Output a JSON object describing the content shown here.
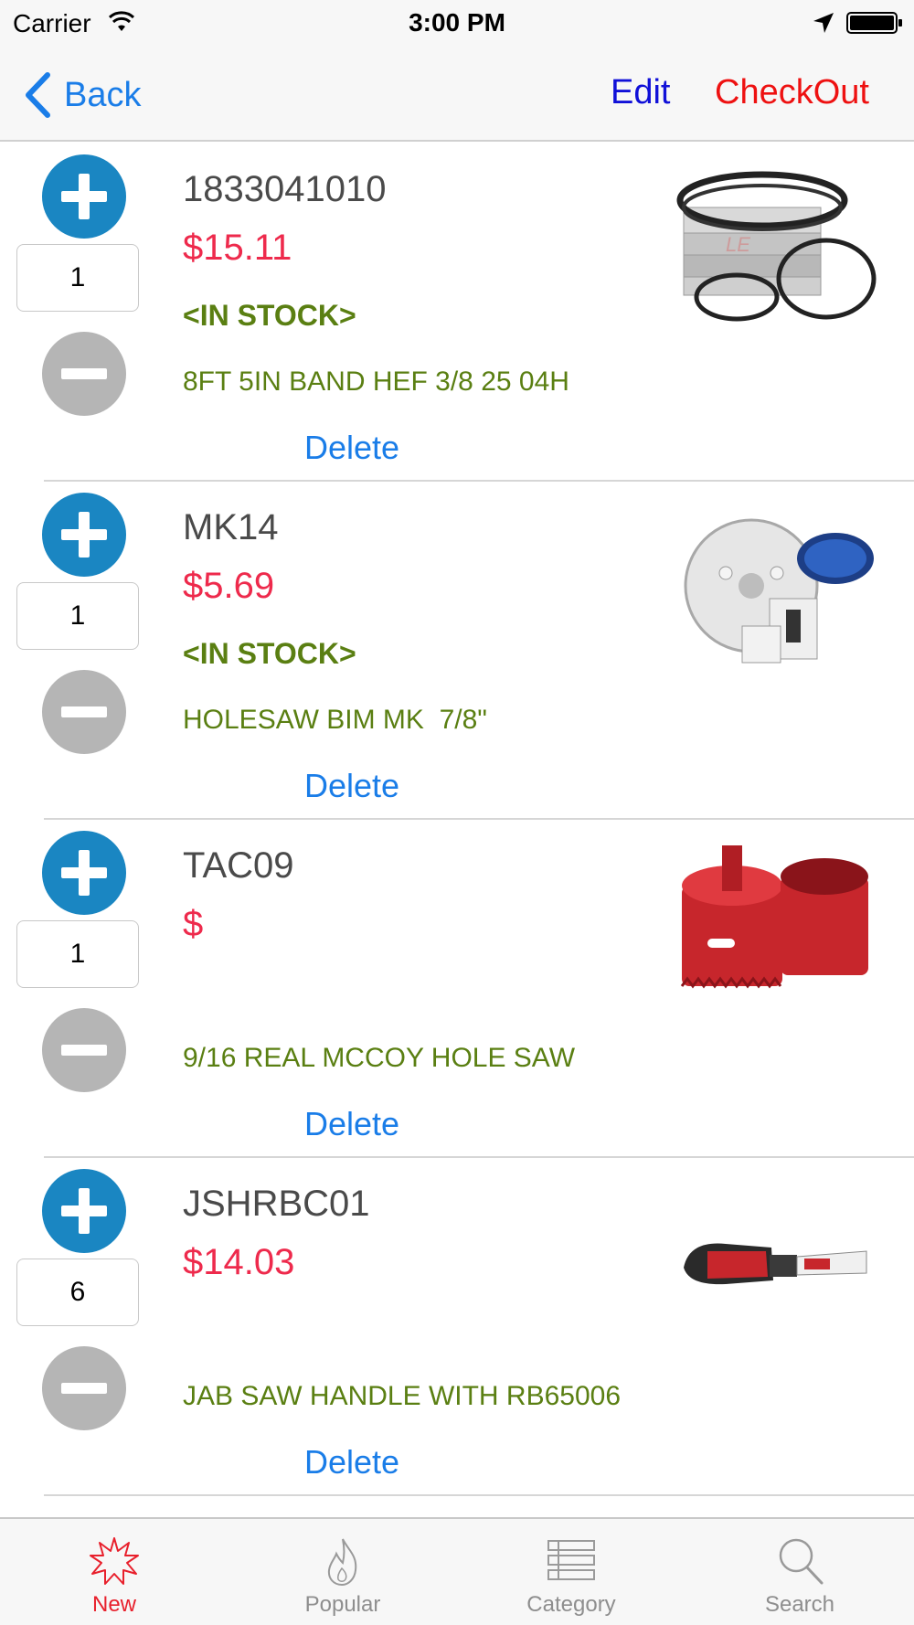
{
  "status_bar": {
    "carrier": "Carrier",
    "time": "3:00 PM",
    "icons": [
      "wifi-icon",
      "location-arrow-icon",
      "battery-icon"
    ]
  },
  "nav": {
    "back_label": "Back",
    "edit_label": "Edit",
    "checkout_label": "CheckOut",
    "colors": {
      "back": "#1a7de8",
      "edit": "#1010d8",
      "checkout": "#ee1111"
    }
  },
  "cart": {
    "delete_label": "Delete",
    "colors": {
      "price": "#ee2a4c",
      "stock": "#5a7f12",
      "plus": "#1a86c2",
      "minus": "#b5b5b5"
    },
    "items": [
      {
        "sku": "1833041010",
        "price": "$15.11",
        "stock": "<IN STOCK>",
        "description": "8FT 5IN BAND HEF 3/8 25 04H",
        "quantity": "1",
        "image": "band-saw-blade-product-image"
      },
      {
        "sku": "MK14",
        "price": "$5.69",
        "stock": "<IN STOCK>",
        "description": "HOLESAW BIM MK  7/8\"",
        "quantity": "1",
        "image": "holesaw-product-image"
      },
      {
        "sku": "TAC09",
        "price": "$",
        "stock": "",
        "description": "9/16 REAL MCCOY HOLE SAW",
        "quantity": "1",
        "image": "red-hole-saw-product-image"
      },
      {
        "sku": "JSHRBC01",
        "price": "$14.03",
        "stock": "",
        "description": "JAB SAW HANDLE WITH RB65006",
        "quantity": "6",
        "image": "jab-saw-handle-product-image"
      }
    ]
  },
  "tabs": [
    {
      "label": "New",
      "icon": "starburst-icon",
      "active": true
    },
    {
      "label": "Popular",
      "icon": "flame-icon",
      "active": false
    },
    {
      "label": "Category",
      "icon": "list-icon",
      "active": false
    },
    {
      "label": "Search",
      "icon": "magnifier-icon",
      "active": false
    }
  ],
  "tab_colors": {
    "active": "#e8202c",
    "inactive": "#8e8e8e"
  }
}
